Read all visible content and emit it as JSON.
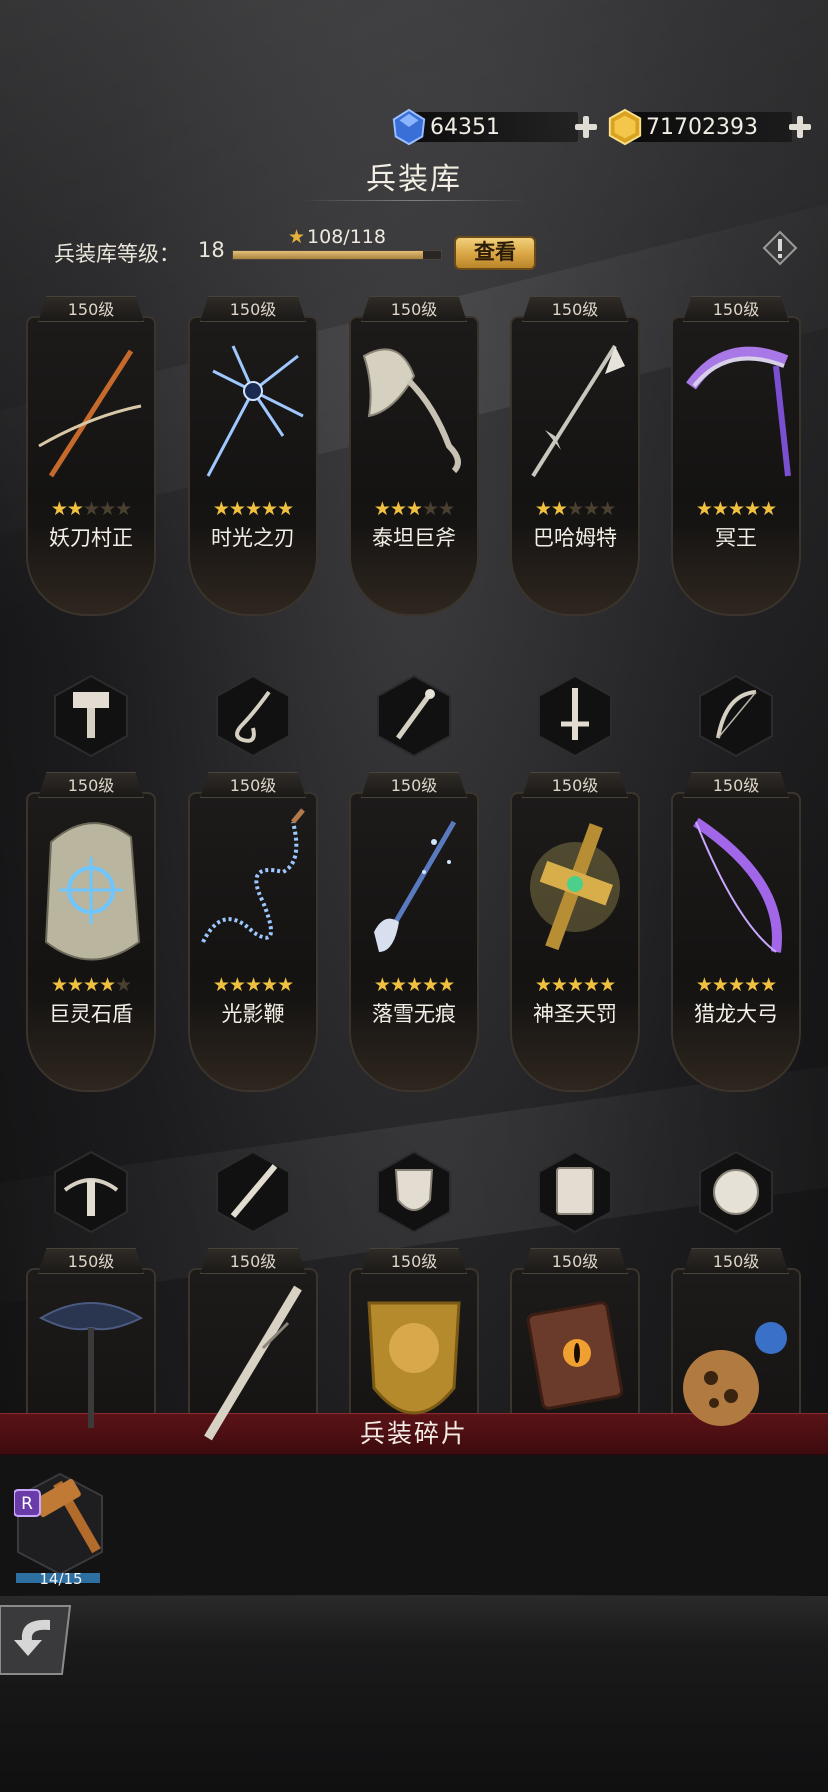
{
  "currency": {
    "gems": {
      "value": "64351",
      "icon": "blue-gem-icon"
    },
    "gold": {
      "value": "71702393",
      "icon": "gold-coin-icon"
    }
  },
  "page_title": "兵装库",
  "armory_level": {
    "label": "兵装库等级：",
    "level": "18",
    "progress_text": "108/118",
    "progress_fraction": 0.915,
    "view_button": "查看"
  },
  "weapons_row1": [
    {
      "level": "150级",
      "name": "妖刀村正",
      "stars": 2
    },
    {
      "level": "150级",
      "name": "时光之刃",
      "stars": 5
    },
    {
      "level": "150级",
      "name": "泰坦巨斧",
      "stars": 3
    },
    {
      "level": "150级",
      "name": "巴哈姆特",
      "stars": 2
    },
    {
      "level": "150级",
      "name": "冥王",
      "stars": 5
    }
  ],
  "category_row2": [
    "hammer-icon",
    "whip-icon",
    "staff-icon",
    "sword-icon",
    "bow-icon"
  ],
  "weapons_row2": [
    {
      "level": "150级",
      "name": "巨灵石盾",
      "stars": 4
    },
    {
      "level": "150级",
      "name": "光影鞭",
      "stars": 5
    },
    {
      "level": "150级",
      "name": "落雪无痕",
      "stars": 5
    },
    {
      "level": "150级",
      "name": "神圣天罚",
      "stars": 5
    },
    {
      "level": "150级",
      "name": "猎龙大弓",
      "stars": 5
    }
  ],
  "category_row3": [
    "crossbow-icon",
    "rifle-icon",
    "shield-icon",
    "book-icon",
    "orb-icon"
  ],
  "weapons_row3": [
    {
      "level": "150级"
    },
    {
      "level": "150级"
    },
    {
      "level": "150级"
    },
    {
      "level": "150级"
    },
    {
      "level": "150级"
    }
  ],
  "fragments": {
    "title": "兵装碎片",
    "items": [
      {
        "rarity": "R",
        "count": "14/15",
        "fraction": 0.933
      }
    ]
  }
}
